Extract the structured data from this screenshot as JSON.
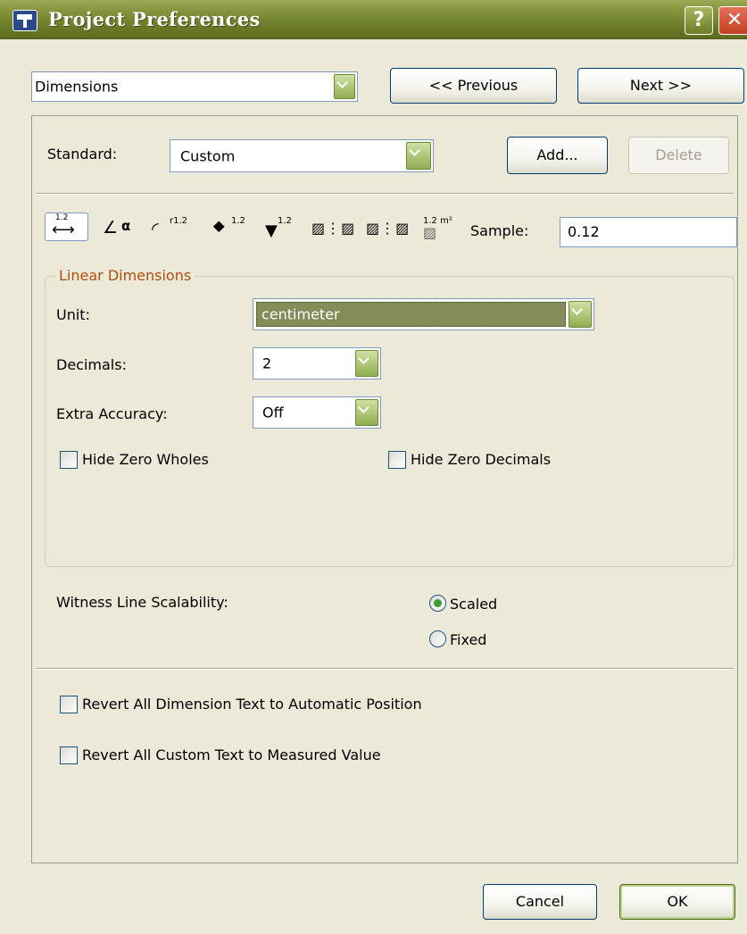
{
  "window": {
    "title": "Project Preferences",
    "help_glyph": "?",
    "close_glyph": "✕"
  },
  "navigation": {
    "section_value": "Dimensions",
    "previous_label": "<< Previous",
    "next_label": "Next >>"
  },
  "standard": {
    "label": "Standard:",
    "value": "Custom",
    "add_label": "Add...",
    "delete_label": "Delete"
  },
  "dimension_types": {
    "icons": [
      {
        "name": "linear-dimension-icon",
        "glyph": "⟷",
        "sup": "1.2"
      },
      {
        "name": "angle-dimension-icon",
        "glyph": "∠",
        "sup": "α"
      },
      {
        "name": "radius-dimension-icon",
        "glyph": "◜",
        "sup": "r1.2"
      },
      {
        "name": "level-dimension-icon",
        "glyph": "⯁",
        "sup": "1.2"
      },
      {
        "name": "elevation-dimension-icon",
        "glyph": "▼",
        "sup": "1.2"
      },
      {
        "name": "door-window-dimension-icon",
        "glyph": "▨⋮▨",
        "sup": ""
      },
      {
        "name": "sill-height-dimension-icon",
        "glyph": "▨⋮▨",
        "sup": ""
      },
      {
        "name": "area-dimension-icon",
        "glyph": "▨",
        "sup": "1.2 m²"
      }
    ],
    "sample_label": "Sample:",
    "sample_value": "0.12"
  },
  "linear_dimensions": {
    "legend": "Linear Dimensions",
    "unit_label": "Unit:",
    "unit_value": "centimeter",
    "decimals_label": "Decimals:",
    "decimals_value": "2",
    "extra_accuracy_label": "Extra Accuracy:",
    "extra_accuracy_value": "Off",
    "hide_zero_wholes_label": "Hide Zero Wholes",
    "hide_zero_wholes_checked": false,
    "hide_zero_decimals_label": "Hide Zero Decimals",
    "hide_zero_decimals_checked": false
  },
  "witness_line": {
    "label": "Witness Line Scalability:",
    "options": [
      {
        "label": "Scaled",
        "selected": true
      },
      {
        "label": "Fixed",
        "selected": false
      }
    ]
  },
  "revert": {
    "automatic_position_label": "Revert All Dimension Text to Automatic Position",
    "measured_value_label": "Revert All Custom Text to Measured Value"
  },
  "footer": {
    "cancel_label": "Cancel",
    "ok_label": "OK"
  },
  "colors": {
    "titlebar": "#7f9038",
    "dialog_bg": "#ece9d8",
    "selected_unit_bg": "#848c5a",
    "legend_text": "#b04d10",
    "radio_dot": "#3d9d2f"
  }
}
